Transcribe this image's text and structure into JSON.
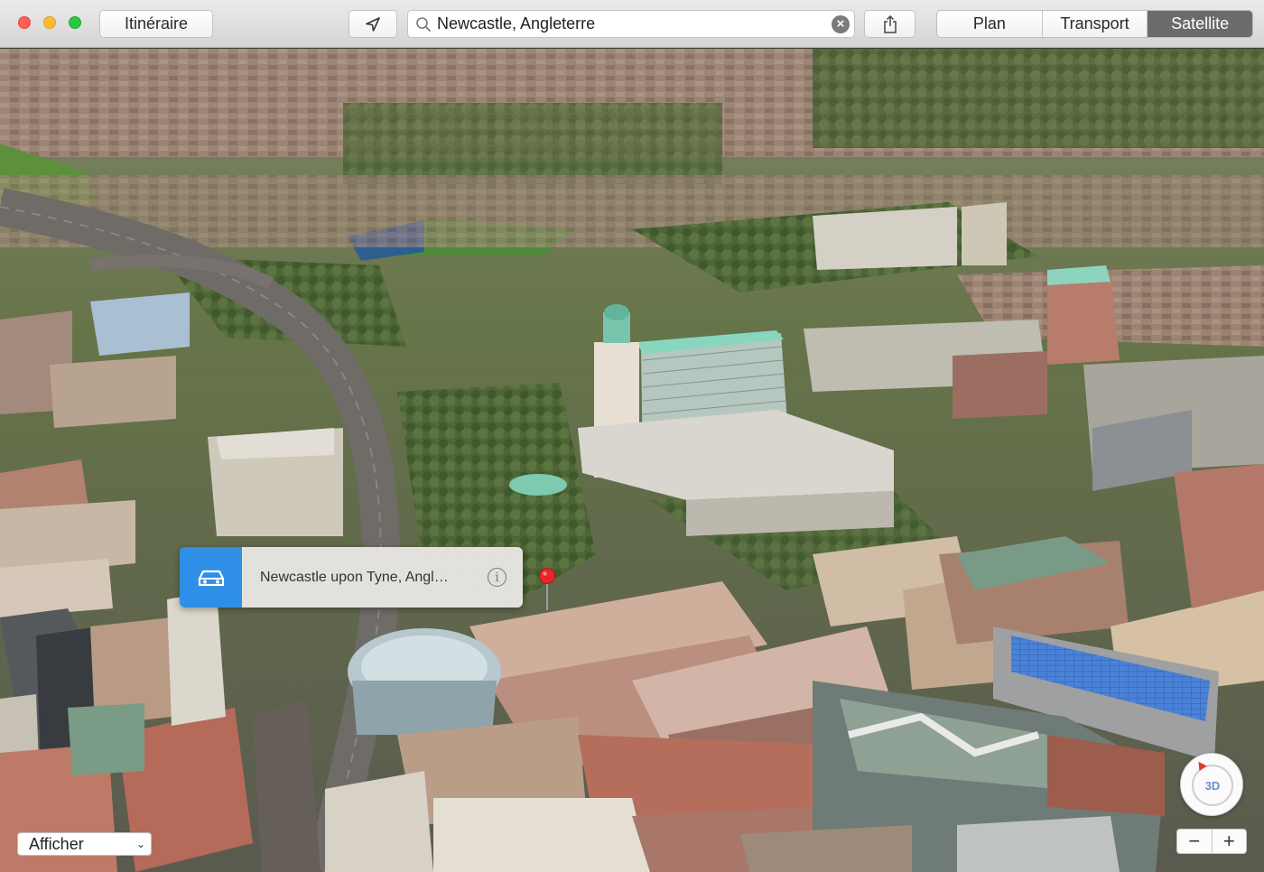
{
  "window": {
    "controls": [
      "close",
      "minimize",
      "zoom"
    ]
  },
  "toolbar": {
    "route_label": "Itinéraire",
    "locate_icon": "location-arrow-icon",
    "search": {
      "value": "Newcastle, Angleterre",
      "icon": "search-icon",
      "clear_icon": "clear-icon"
    },
    "share_icon": "share-icon",
    "map_modes": [
      {
        "label": "Plan",
        "active": false
      },
      {
        "label": "Transport",
        "active": false
      },
      {
        "label": "Satellite",
        "active": true
      }
    ]
  },
  "callout": {
    "icon": "car-icon",
    "title": "Newcastle upon Tyne, Angl…",
    "info_icon": "info-icon",
    "pin_color": "#e8262a"
  },
  "bottom": {
    "show_label": "Afficher",
    "compass_label": "3D",
    "zoom_out": "−",
    "zoom_in": "+"
  },
  "colors": {
    "accent": "#2f8ee6",
    "segment_active": "#6b6b6b"
  }
}
